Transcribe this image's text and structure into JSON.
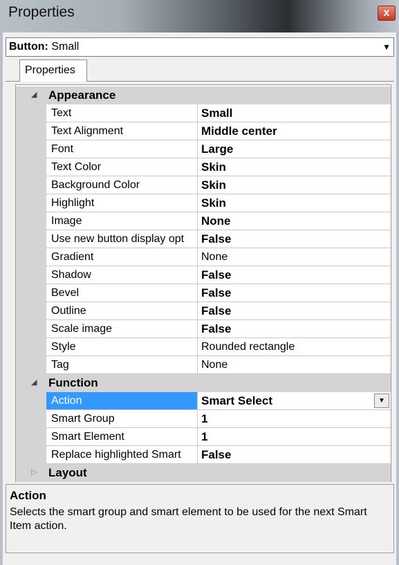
{
  "window": {
    "title": "Properties",
    "close_glyph": "x"
  },
  "object_selector": {
    "prefix": "Button:",
    "value": "Small"
  },
  "tabs": [
    {
      "label": "Properties"
    }
  ],
  "categories": {
    "appearance": {
      "label": "Appearance",
      "expanded": true,
      "rows": [
        {
          "name": "Text",
          "value": "Small",
          "bold": true
        },
        {
          "name": "Text Alignment",
          "value": "Middle center",
          "bold": true
        },
        {
          "name": "Font",
          "value": "Large",
          "bold": true
        },
        {
          "name": "Text Color",
          "value": "Skin",
          "bold": true
        },
        {
          "name": "Background Color",
          "value": "Skin",
          "bold": true
        },
        {
          "name": "Highlight",
          "value": "Skin",
          "bold": true
        },
        {
          "name": "Image",
          "value": "None",
          "bold": true
        },
        {
          "name": "Use new button display opt",
          "value": "False",
          "bold": true
        },
        {
          "name": "Gradient",
          "value": "None",
          "bold": false
        },
        {
          "name": "Shadow",
          "value": "False",
          "bold": true
        },
        {
          "name": "Bevel",
          "value": "False",
          "bold": true
        },
        {
          "name": "Outline",
          "value": "False",
          "bold": true
        },
        {
          "name": "Scale image",
          "value": "False",
          "bold": true
        },
        {
          "name": "Style",
          "value": "Rounded rectangle",
          "bold": false
        },
        {
          "name": "Tag",
          "value": "None",
          "bold": false
        }
      ]
    },
    "function": {
      "label": "Function",
      "expanded": true,
      "rows": [
        {
          "name": "Action",
          "value": "Smart Select",
          "bold": true,
          "selected": true
        },
        {
          "name": "Smart Group",
          "value": "1",
          "bold": true
        },
        {
          "name": "Smart Element",
          "value": "1",
          "bold": true
        },
        {
          "name": "Replace highlighted Smart",
          "value": "False",
          "bold": true
        }
      ]
    },
    "layout": {
      "label": "Layout",
      "expanded": false
    }
  },
  "description": {
    "title": "Action",
    "text": "Selects the smart group and smart element to be used for the next Smart Item action."
  },
  "colors": {
    "selection": "#3399ff",
    "category_band": "#d4d4d4",
    "close_button": "#c23b22"
  }
}
